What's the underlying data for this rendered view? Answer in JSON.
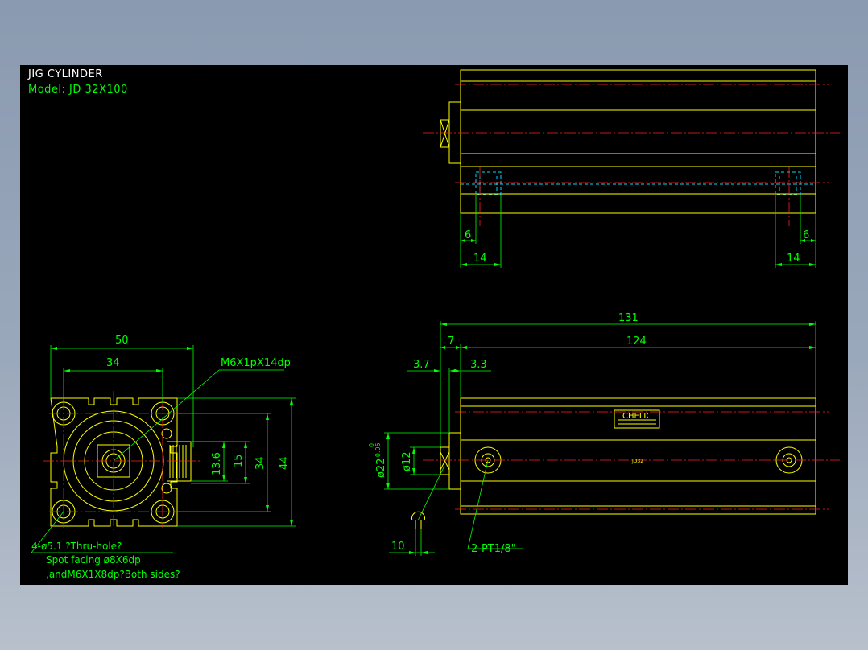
{
  "title": "JIG CYLINDER",
  "model": "Model: JD 32X100",
  "dimensions": {
    "d50": "50",
    "d34_top": "34",
    "d13_6": "13.6",
    "d15": "15",
    "d34_side": "34",
    "d44": "44",
    "thread_callout": "M6X1pX14dp",
    "d131": "131",
    "d7": "7",
    "d124": "124",
    "d3_7": "3.7",
    "d3_3": "3.3",
    "d12": "ø12",
    "d22": "ø22",
    "d22_upper": "0",
    "d22_lower": "-0.05",
    "d10": "10",
    "d6_left": "6",
    "d14_left": "14",
    "d6_right": "6",
    "d14_right": "14",
    "port": "2-PT1/8\""
  },
  "notes": {
    "line1": "4-ø5.1 ?Thru-hole?",
    "line2": "Spot facing ø8X6dp",
    "line3": ",andM6X1X8dp?Both sides?"
  },
  "label": {
    "brand": "CHELIC",
    "part": "JD32"
  },
  "colors": {
    "outline": "#ffff00",
    "dimension": "#00ff00",
    "centerline": "#ff2020",
    "hidden": "#00d8ff",
    "background": "#000000"
  }
}
